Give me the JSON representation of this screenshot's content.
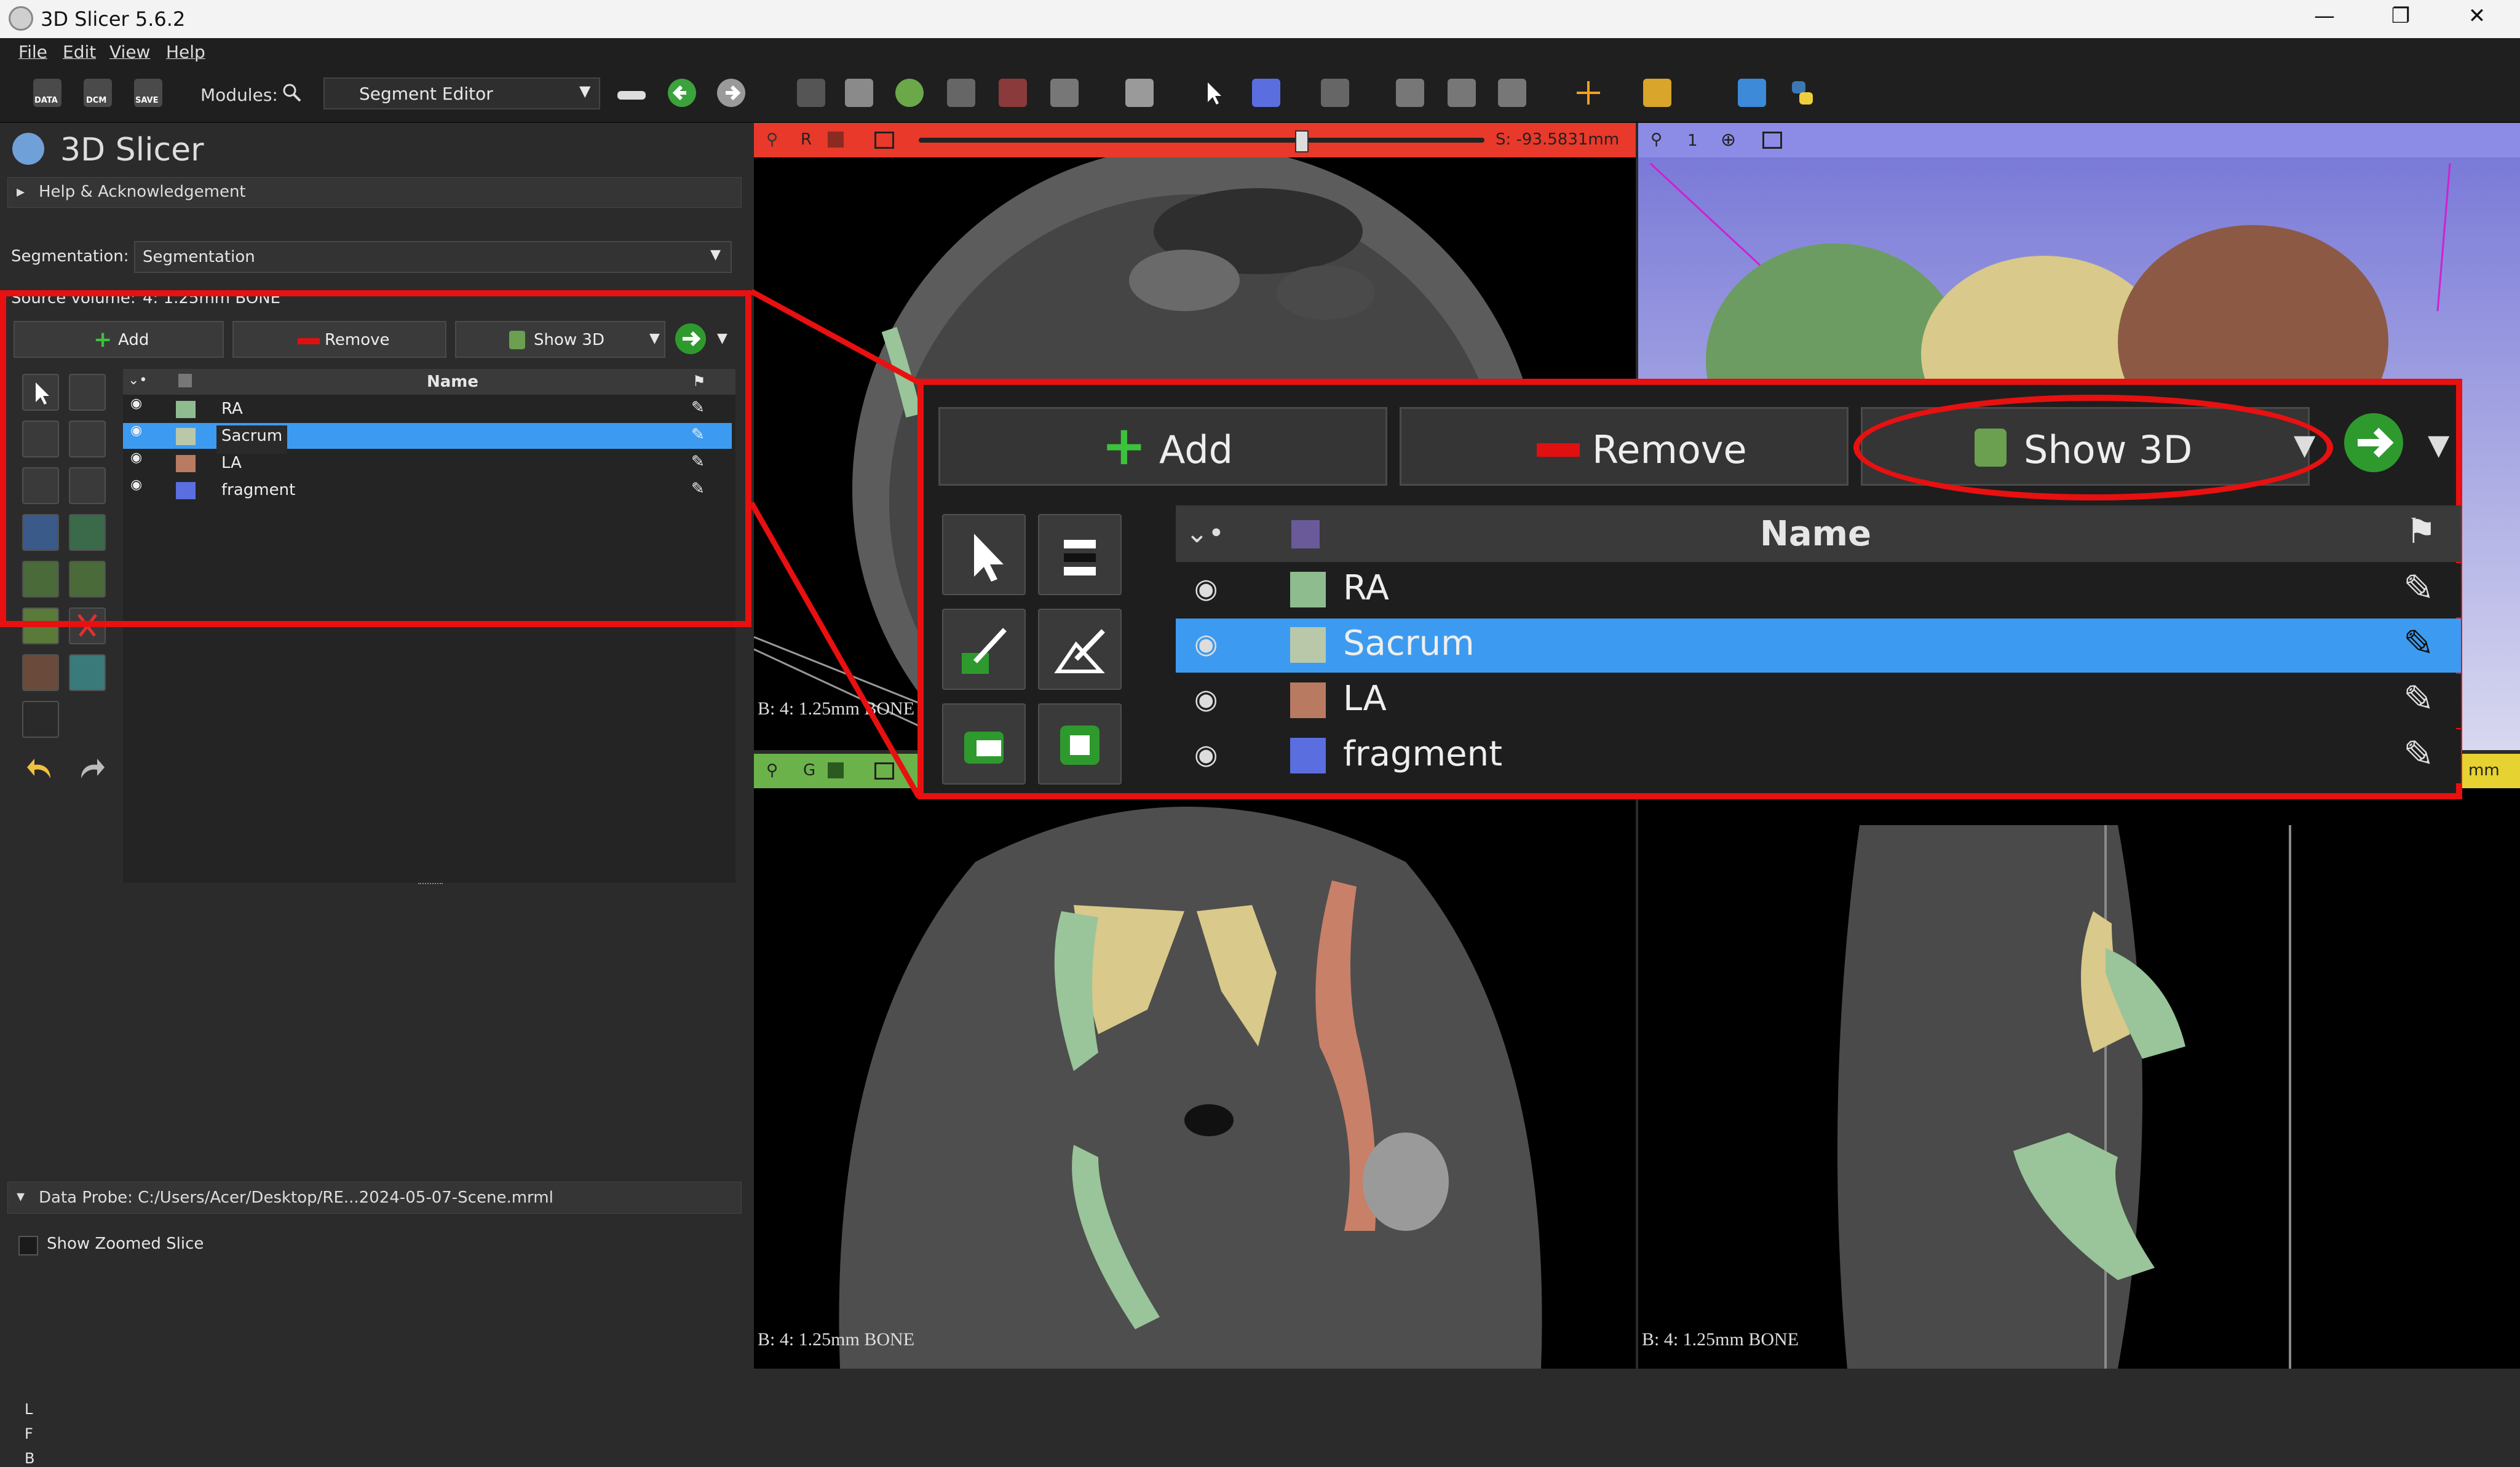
{
  "window": {
    "title": "3D Slicer 5.6.2",
    "minimize_glyph": "—",
    "maximize_glyph": "❐",
    "close_glyph": "✕"
  },
  "menu": [
    "File",
    "Edit",
    "View",
    "Help"
  ],
  "toolbar": {
    "data_label": "DATA",
    "dcm_label": "DCM",
    "save_label": "SAVE",
    "modules_label": "Modules:",
    "module_selected": "Segment Editor"
  },
  "left_panel": {
    "app_name": "3D Slicer",
    "help_section": "Help & Acknowledgement",
    "segmentation_label": "Segmentation:",
    "segmentation_value": "Segmentation",
    "source_volume_label": "Source volume:",
    "source_volume_value": "4: 1.25mm BONE",
    "add_label": "Add",
    "remove_label": "Remove",
    "show3d_label": "Show 3D",
    "name_header": "Name",
    "segments": [
      {
        "name": "RA",
        "color": "#8fbc8f"
      },
      {
        "name": "Sacrum",
        "color": "#b8c8a8"
      },
      {
        "name": "LA",
        "color": "#b97a62"
      },
      {
        "name": "fragment",
        "color": "#5a6ee0"
      }
    ],
    "data_probe": "Data Probe: C:/Users/Acer/Desktop/RE...2024-05-07-Scene.mrml",
    "show_zoomed_slice": "Show Zoomed Slice",
    "probe_lines": [
      "L",
      "F",
      "B"
    ]
  },
  "views": {
    "red": {
      "label": "R",
      "offset": "S: -93.5831mm",
      "slider_fraction": 0.68,
      "color": "#e8392a",
      "volume": "B: 4: 1.25mm BONE"
    },
    "threed": {
      "label": "1",
      "color": "#8c8ce6"
    },
    "green": {
      "label": "G",
      "volume": "B: 4: 1.25mm BONE",
      "color": "#6bb24a"
    },
    "yellow": {
      "offset_tail": "mm",
      "volume": "B: 4: 1.25mm BONE",
      "color": "#e6d230"
    }
  },
  "callout": {
    "add_label": "Add",
    "remove_label": "Remove",
    "show3d_label": "Show 3D",
    "name_header": "Name",
    "segments": [
      {
        "name": "RA",
        "color": "#8fbc8f"
      },
      {
        "name": "Sacrum",
        "color": "#b8c8a8"
      },
      {
        "name": "LA",
        "color": "#b97a62"
      },
      {
        "name": "fragment",
        "color": "#5a6ee0"
      }
    ],
    "selected_index": 1,
    "highlight_color": "#e81010",
    "selection_color": "#3c9bf0"
  }
}
